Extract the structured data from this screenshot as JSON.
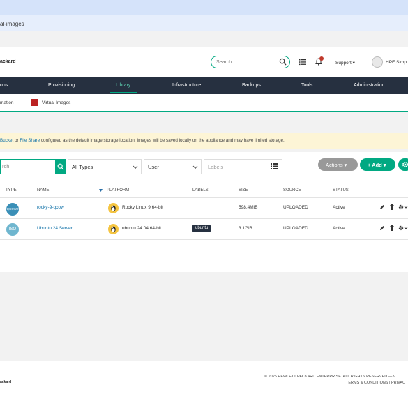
{
  "browser": {
    "url_fragment": "al-images"
  },
  "header": {
    "brand": "ackard",
    "search_placeholder": "Search",
    "support_label": "Support ▾",
    "user_name": "HPE Simp"
  },
  "main_nav": {
    "items": [
      {
        "label": "ons"
      },
      {
        "label": "Provisioning"
      },
      {
        "label": "Library",
        "active": true
      },
      {
        "label": "Infrastructure"
      },
      {
        "label": "Backups"
      },
      {
        "label": "Tools"
      },
      {
        "label": "Administration"
      }
    ]
  },
  "sub_nav": {
    "items": [
      {
        "label": "mation"
      },
      {
        "label": "Virtual Images",
        "icon": "virtual-images-icon"
      }
    ]
  },
  "alert": {
    "link_bucket": "Bucket",
    "text_or": " or ",
    "link_fileshare": "File Share",
    "text_rest": " configured as the default image storage location. Images will be saved locally on the appliance and may have limited storage."
  },
  "filters": {
    "search_value": "rch",
    "type_select": "All Types",
    "owner_select": "User",
    "labels_placeholder": "Labels"
  },
  "toolbar": {
    "actions_label": "Actions ▾",
    "add_label": "+ Add ▾"
  },
  "table": {
    "columns": {
      "type": "TYPE",
      "name": "NAME",
      "platform": "PLATFORM",
      "labels": "LABELS",
      "size": "SIZE",
      "source": "SOURCE",
      "status": "STATUS"
    },
    "rows": [
      {
        "type": "QCOW2",
        "name": "rocky-9-qcow",
        "platform": "Rocky Linux 9 64-bit",
        "labels": "",
        "size": "598.4MiB",
        "source": "UPLOADED",
        "status": "Active"
      },
      {
        "type": "ISO",
        "name": "Ubuntu 24 Server",
        "platform": "ubuntu 24.04 64-bit",
        "labels": "ubuntu",
        "size": "3.1GiB",
        "source": "UPLOADED",
        "status": "Active"
      }
    ]
  },
  "footer": {
    "brand": "ackard",
    "copyright": "© 2025 HEWLETT PACKARD ENTERPRISE. ALL RIGHTS RESERVED  —  V",
    "links": "TERMS & CONDITIONS   |   PRIVAC"
  },
  "colors": {
    "accent": "#01a982",
    "nav_bg": "#263040",
    "link": "#0b6ea6",
    "alert_bg": "#fdf5d6",
    "qcow_badge": "#3a8fb7",
    "iso_badge": "#6fb6cf"
  }
}
